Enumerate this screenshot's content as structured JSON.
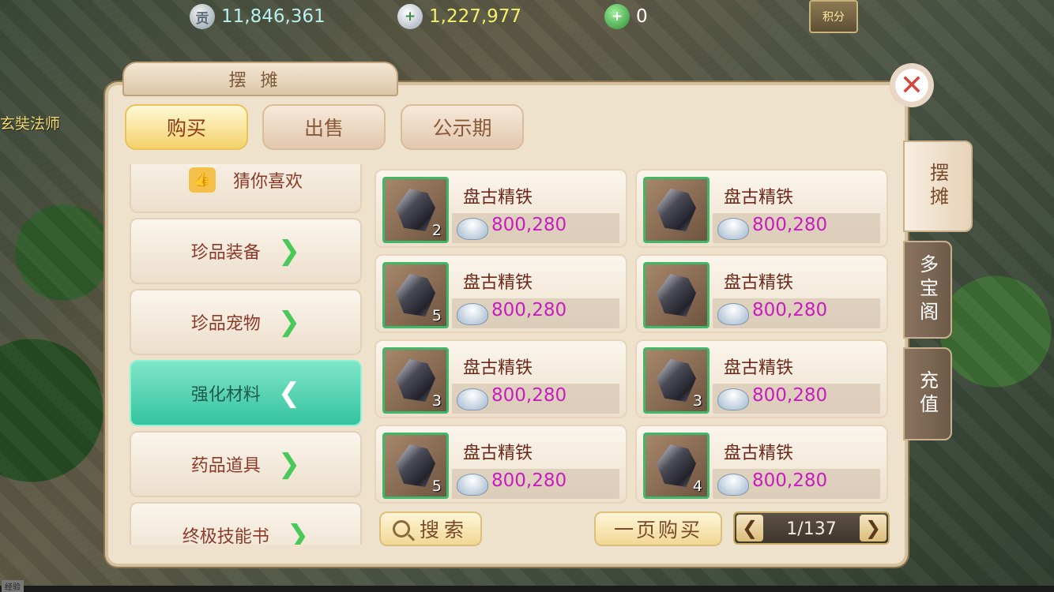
{
  "background": {
    "npc_name": "玄奘法师",
    "exp_label": "经验"
  },
  "currency": {
    "contribution": {
      "icon_label": "贡",
      "icon": "contribution-coin-icon",
      "value": "11,846,361"
    },
    "silver": {
      "icon": "silver-ingot-add-icon",
      "value": "1,227,977"
    },
    "jade": {
      "icon": "jade-add-icon",
      "value": "0"
    },
    "points_label": "积分"
  },
  "panel": {
    "title": "摆摊",
    "close_label": "✕",
    "tabs": [
      {
        "label": "购买",
        "active": true
      },
      {
        "label": "出售",
        "active": false
      },
      {
        "label": "公示期",
        "active": false
      }
    ],
    "side_tabs": [
      {
        "label": "摆摊",
        "active": true
      },
      {
        "label": "多宝阁",
        "active": false
      },
      {
        "label": "充值",
        "active": false
      }
    ]
  },
  "categories": [
    {
      "label": "猜你喜欢",
      "icon": "thumbs-up-icon"
    },
    {
      "label": "珍品装备",
      "chevron": "❯"
    },
    {
      "label": "珍品宠物",
      "chevron": "❯"
    },
    {
      "label": "强化材料",
      "chevron": "❮",
      "active": true
    },
    {
      "label": "药品道具",
      "chevron": "❯"
    },
    {
      "label": "终极技能书",
      "chevron": "❯"
    }
  ],
  "items": [
    {
      "name": "盘古精铁",
      "qty": "2",
      "price": "800,280"
    },
    {
      "name": "盘古精铁",
      "qty": "",
      "price": "800,280"
    },
    {
      "name": "盘古精铁",
      "qty": "5",
      "price": "800,280"
    },
    {
      "name": "盘古精铁",
      "qty": "",
      "price": "800,280"
    },
    {
      "name": "盘古精铁",
      "qty": "3",
      "price": "800,280"
    },
    {
      "name": "盘古精铁",
      "qty": "3",
      "price": "800,280"
    },
    {
      "name": "盘古精铁",
      "qty": "5",
      "price": "800,280"
    },
    {
      "name": "盘古精铁",
      "qty": "4",
      "price": "800,280"
    }
  ],
  "footer": {
    "search_label": "搜索",
    "buy_page_label": "一页购买",
    "prev": "❮",
    "next": "❯",
    "page_indicator": "1/137"
  },
  "colors": {
    "active_category": "#35c39f",
    "price": "#c81cc1",
    "item_border": "#3fb86a",
    "close_x": "#d6463a"
  }
}
